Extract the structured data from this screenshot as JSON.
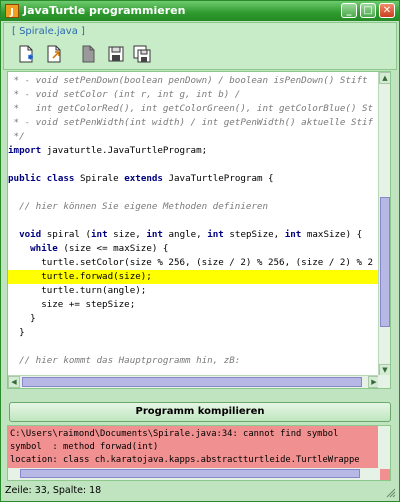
{
  "window": {
    "title": "JavaTurtle programmieren",
    "minimize_label": "_",
    "maximize_label": "□",
    "close_label": "✕"
  },
  "tab": {
    "label": "[ Spirale.java ]"
  },
  "toolbar": {
    "tools": [
      {
        "icon": "new-file-icon"
      },
      {
        "icon": "open-file-icon"
      },
      {
        "icon": "blank-file-icon"
      },
      {
        "icon": "save-icon"
      },
      {
        "icon": "save-as-icon"
      }
    ]
  },
  "editor": {
    "lines": [
      " * - void setPenDown(boolean penDown) / boolean isPenDown() Stift",
      " * - void setColor (int r, int g, int b) /",
      " *   int getColorRed(), int getColorGreen(), int getColorBlue() St",
      " * - void setPenWidth(int width) / int getPenWidth() aktuelle Stif",
      " */",
      "import javaturtle.JavaTurtleProgram;",
      "",
      "public class Spirale extends JavaTurtleProgram {",
      "",
      "  // hier können Sie eigene Methoden definieren",
      "",
      "  void spiral (int size, int angle, int stepSize, int maxSize) {",
      "    while (size <= maxSize) {",
      "      turtle.setColor(size % 256, (size / 2) % 256, (size / 2) % 2",
      "      turtle.forwad(size);",
      "      turtle.turn(angle);",
      "      size += stepSize;",
      "    }",
      "  }",
      "",
      "  // hier kommt das Hauptprogramm hin, zB:"
    ],
    "highlighted_line": 14
  },
  "compile_button": {
    "label": "Programm kompilieren"
  },
  "console": {
    "lines": [
      "C:\\Users\\raimond\\Documents\\Spirale.java:34: cannot find symbol",
      "symbol  : method forwad(int)",
      "location: class ch.karatojava.kapps.abstractturtleide.TurtleWrappe"
    ],
    "error_color": "#f09090"
  },
  "status": {
    "text": "Zeile: 33, Spalte: 18"
  },
  "colors": {
    "title_bar": "#2e9a2e",
    "background": "#c0e4c0",
    "highlight": "#ffff00",
    "keyword": "#000080",
    "comment": "#7a7a7a"
  }
}
